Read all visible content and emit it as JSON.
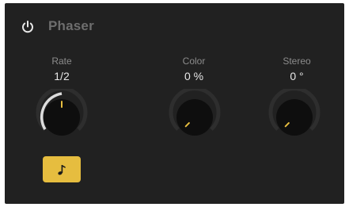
{
  "plugin": {
    "title": "Phaser",
    "power_on": true
  },
  "params": {
    "rate": {
      "label": "Rate",
      "value": "1/2"
    },
    "color": {
      "label": "Color",
      "value": "0 %"
    },
    "stereo": {
      "label": "Stereo",
      "value": "0 °"
    }
  },
  "sync_button": {
    "icon": "eighth-note-icon",
    "active": true
  },
  "colors": {
    "background": "#212121",
    "accent": "#e6bd3f",
    "arc_active": "#e0e0e0",
    "title_dim": "#6e6e6e"
  }
}
